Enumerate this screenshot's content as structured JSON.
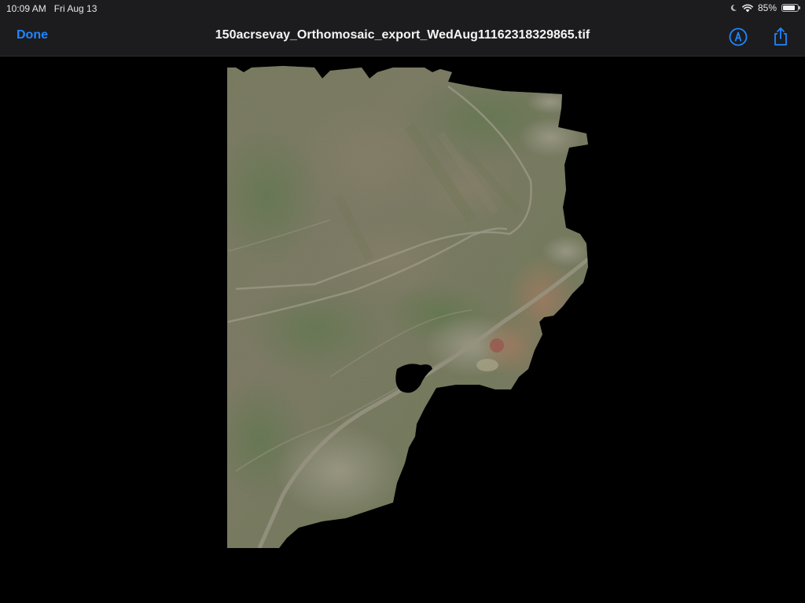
{
  "status_bar": {
    "time": "10:09 AM",
    "date": "Fri Aug 13",
    "battery_percent_label": "85%",
    "battery_level": 0.85,
    "icons": [
      "moon-icon",
      "wifi-icon",
      "battery-icon"
    ]
  },
  "nav_bar": {
    "done_label": "Done",
    "title": "150acrsevay_Orthomosaic_export_WedAug11162318329865.tif",
    "markup_icon": "markup-pen-icon",
    "share_icon": "share-icon"
  },
  "colors": {
    "accent": "#1f86ff",
    "bar_background": "#1c1c1e",
    "viewer_background": "#000000",
    "terrain_green": "#6f7d55",
    "terrain_brown": "#8a8068",
    "clay_orange": "#c4785a",
    "road_tan": "#b9b2a0"
  }
}
